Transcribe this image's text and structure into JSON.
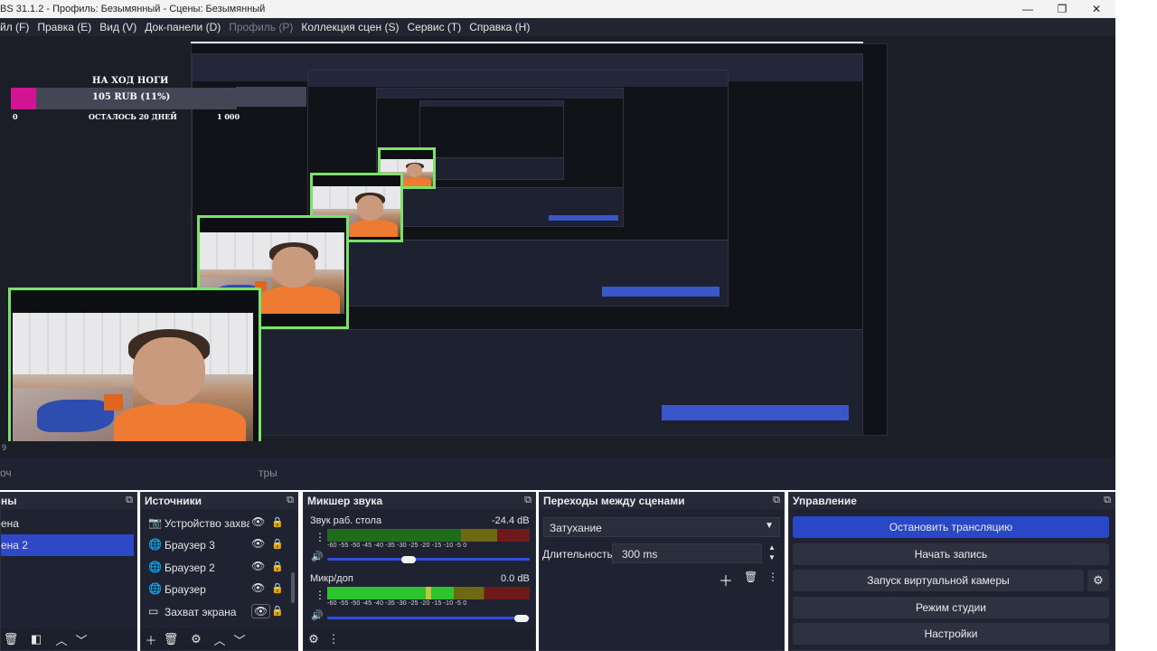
{
  "window": {
    "title": "BS 31.1.2 - Профиль: Безымянный - Сцены: Безымянный",
    "minimize_glyph": "—",
    "maximize_glyph": "❐",
    "close_glyph": "✕"
  },
  "menu": [
    {
      "label": "йл (F)",
      "enabled": true
    },
    {
      "label": "Правка (E)",
      "enabled": true
    },
    {
      "label": "Вид (V)",
      "enabled": true
    },
    {
      "label": "Док-панели (D)",
      "enabled": true
    },
    {
      "label": "Профиль (P)",
      "enabled": false
    },
    {
      "label": "Коллекция сцен (S)",
      "enabled": true
    },
    {
      "label": "Сервис (T)",
      "enabled": true
    },
    {
      "label": "Справка (H)",
      "enabled": true
    }
  ],
  "widget": {
    "title": "НА ХОД НОГИ",
    "amount": "105 RUB (11%)",
    "progress_fraction": 0.11,
    "min": "0",
    "days_left": "ОСТАЛОСЬ 20 ДНЕЙ",
    "max": "1 000",
    "fill_color": "#d11592"
  },
  "strip": {
    "dot": "9"
  },
  "tabs": {
    "left": "оч",
    "right": "тры"
  },
  "scenes": {
    "title": "ны",
    "popout_icon": "popout-icon",
    "items": [
      {
        "label": "ена",
        "active": false
      },
      {
        "label": "ена 2",
        "active": true
      }
    ]
  },
  "sources": {
    "title": "Источники",
    "items": [
      {
        "label": "Устройство захва",
        "icon": "camera-icon"
      },
      {
        "label": "Браузер 3",
        "icon": "globe-icon"
      },
      {
        "label": "Браузер 2",
        "icon": "globe-icon"
      },
      {
        "label": "Браузер",
        "icon": "globe-icon"
      },
      {
        "label": "Захват экрана",
        "icon": "monitor-icon"
      }
    ]
  },
  "mixer": {
    "title": "Микшер звука",
    "channels": [
      {
        "name": "Звук раб. стола",
        "db": "-24.4 dB",
        "volume_fraction": 0.4
      },
      {
        "name": "Микр/доп",
        "db": "0.0 dB",
        "volume_fraction": 0.96
      }
    ],
    "ticks": "-60 -55 -50 -45 -40 -35 -30 -25 -20 -15 -10 -5 0"
  },
  "transitions": {
    "title": "Переходы между сценами",
    "type": "Затухание",
    "duration_label": "Длительность",
    "duration_value": "300 ms"
  },
  "controls": {
    "title": "Управление",
    "buttons": {
      "stop_stream": "Остановить трансляцию",
      "start_record": "Начать запись",
      "virtual_cam": "Запуск виртуальной камеры",
      "studio_mode": "Режим студии",
      "settings": "Настройки"
    }
  },
  "colors": {
    "accent": "#2a47c8",
    "cam_border": "#7be36a",
    "panel_bg": "#1f2230"
  }
}
